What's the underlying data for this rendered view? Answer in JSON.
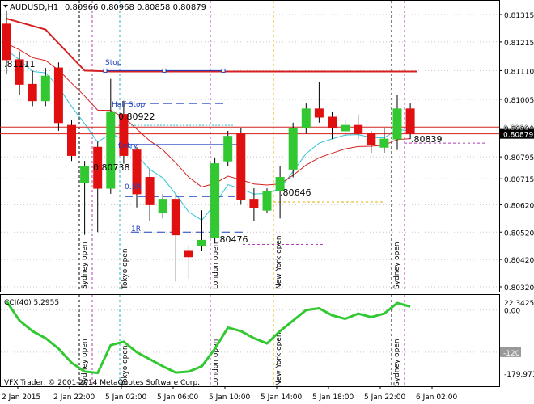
{
  "header": {
    "symbol_tf": "AUDUSD,H1",
    "ohlc": "0.80966 0.80968 0.80858 0.80879"
  },
  "price_axis": {
    "ticks": [
      "0.81315",
      "0.81215",
      "0.81110",
      "0.81005",
      "0.80900",
      "0.80795",
      "0.80715",
      "0.80620",
      "0.80520",
      "0.80420",
      "0.80320"
    ],
    "current_bid_label": "0.80904",
    "current_price_label": "0.80879"
  },
  "cci_panel": {
    "label": "CCI(40) 5.2955",
    "axis_ticks": [
      "22.3425",
      "0.00",
      "-179.971"
    ],
    "neg120_label": "-120",
    "copyright": "VFX Trader, © 2001-2014 MetaQuotes Software Corp."
  },
  "time_axis": [
    "2 Jan 2015",
    "2 Jan 22:00",
    "5 Jan 02:00",
    "5 Jan 06:00",
    "5 Jan 10:00",
    "5 Jan 14:00",
    "5 Jan 18:00",
    "5 Jan 22:00",
    "6 Jan 02:00"
  ],
  "session_labels": [
    "Sydney open",
    "Tokyo open",
    "London open",
    "New York open",
    "Sydney open"
  ],
  "annotations": {
    "stop": "Stop",
    "half_stop": "Half Stop",
    "entry": "Entry",
    "half_r": "0.5R",
    "one_r": "1R",
    "p_81111": ".81111",
    "p_80922": "0.80922",
    "p_80738": "0.80738",
    "p_80646": ".80646",
    "p_80476": ".80476",
    "p_80839": ".80839"
  },
  "candles": [
    {
      "o": 0.8128,
      "h": 0.8133,
      "l": 0.811,
      "c": 0.8115
    },
    {
      "o": 0.8115,
      "h": 0.8118,
      "l": 0.8102,
      "c": 0.8106
    },
    {
      "o": 0.8106,
      "h": 0.8111,
      "l": 0.8098,
      "c": 0.81
    },
    {
      "o": 0.81,
      "h": 0.8112,
      "l": 0.8098,
      "c": 0.8109
    },
    {
      "o": 0.8112,
      "h": 0.8114,
      "l": 0.8089,
      "c": 0.8092
    },
    {
      "o": 0.8091,
      "h": 0.8093,
      "l": 0.8078,
      "c": 0.808
    },
    {
      "o": 0.807,
      "h": 0.8078,
      "l": 0.8051,
      "c": 0.8076
    },
    {
      "o": 0.8083,
      "h": 0.8085,
      "l": 0.8052,
      "c": 0.8068
    },
    {
      "o": 0.8068,
      "h": 0.8108,
      "l": 0.8066,
      "c": 0.8096
    },
    {
      "o": 0.8095,
      "h": 0.81,
      "l": 0.8077,
      "c": 0.808
    },
    {
      "o": 0.8082,
      "h": 0.8083,
      "l": 0.8061,
      "c": 0.8066
    },
    {
      "o": 0.8072,
      "h": 0.8075,
      "l": 0.8056,
      "c": 0.8062
    },
    {
      "o": 0.8059,
      "h": 0.8066,
      "l": 0.8057,
      "c": 0.8064
    },
    {
      "o": 0.8064,
      "h": 0.8066,
      "l": 0.8034,
      "c": 0.8051
    },
    {
      "o": 0.8045,
      "h": 0.8047,
      "l": 0.8035,
      "c": 0.8043
    },
    {
      "o": 0.8047,
      "h": 0.806,
      "l": 0.8045,
      "c": 0.8049
    },
    {
      "o": 0.805,
      "h": 0.8079,
      "l": 0.8048,
      "c": 0.8077
    },
    {
      "o": 0.8078,
      "h": 0.8089,
      "l": 0.8076,
      "c": 0.8087
    },
    {
      "o": 0.8088,
      "h": 0.809,
      "l": 0.8062,
      "c": 0.8064
    },
    {
      "o": 0.8064,
      "h": 0.8068,
      "l": 0.8056,
      "c": 0.8061
    },
    {
      "o": 0.806,
      "h": 0.8068,
      "l": 0.8059,
      "c": 0.8067
    },
    {
      "o": 0.8067,
      "h": 0.8076,
      "l": 0.8057,
      "c": 0.8072
    },
    {
      "o": 0.8075,
      "h": 0.8092,
      "l": 0.8072,
      "c": 0.809
    },
    {
      "o": 0.809,
      "h": 0.8099,
      "l": 0.8088,
      "c": 0.8097
    },
    {
      "o": 0.8097,
      "h": 0.8107,
      "l": 0.8092,
      "c": 0.8094
    },
    {
      "o": 0.8094,
      "h": 0.8096,
      "l": 0.8086,
      "c": 0.809
    },
    {
      "o": 0.8089,
      "h": 0.8093,
      "l": 0.8087,
      "c": 0.8091
    },
    {
      "o": 0.8091,
      "h": 0.8095,
      "l": 0.8086,
      "c": 0.8088
    },
    {
      "o": 0.8088,
      "h": 0.8089,
      "l": 0.8081,
      "c": 0.8084
    },
    {
      "o": 0.8083,
      "h": 0.809,
      "l": 0.8081,
      "c": 0.8086
    },
    {
      "o": 0.8086,
      "h": 0.8102,
      "l": 0.8082,
      "c": 0.8097
    },
    {
      "o": 0.8097,
      "h": 0.8099,
      "l": 0.8086,
      "c": 0.8088
    }
  ],
  "cci_values": [
    25,
    -30,
    -60,
    -80,
    -110,
    -150,
    -175,
    -179,
    -100,
    -90,
    -120,
    -140,
    -160,
    -178,
    -175,
    -160,
    -110,
    -50,
    -60,
    -80,
    -95,
    -60,
    -30,
    0,
    5,
    -15,
    -25,
    -10,
    -20,
    -10,
    20,
    10
  ],
  "levels": {
    "stop": 0.8111,
    "half_stop": 0.8099,
    "entry": 0.8084,
    "half_r": 0.8065,
    "one_r": 0.8052,
    "red_ma": 0.81107,
    "current": 0.80879,
    "bid": 0.80904
  }
}
